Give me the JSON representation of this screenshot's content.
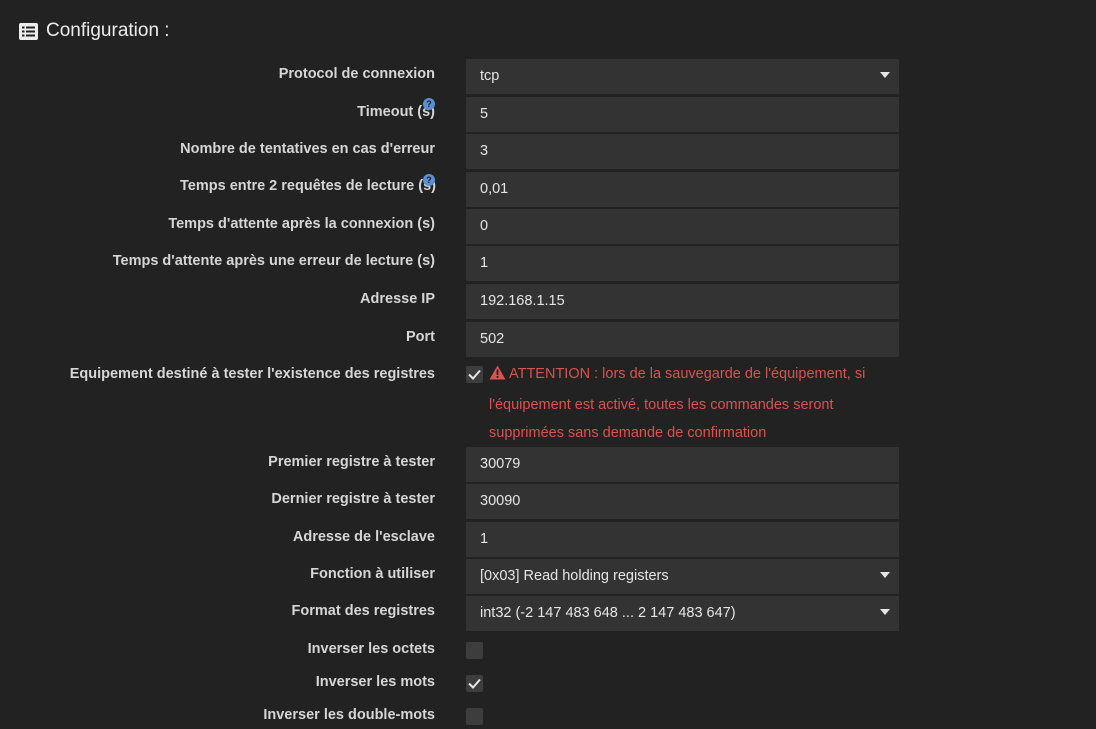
{
  "header": {
    "icon": "list-alt-icon",
    "title": "Configuration :"
  },
  "fields": {
    "protocol": {
      "label": "Protocol de connexion",
      "value": "tcp"
    },
    "timeout": {
      "label": "Timeout (s)",
      "value": "5"
    },
    "retries": {
      "label": "Nombre de tentatives en cas d'erreur",
      "value": "3"
    },
    "read_delay": {
      "label": "Temps entre 2 requêtes de lecture (s)",
      "value": "0,01"
    },
    "connect_wait": {
      "label": "Temps d'attente après la connexion (s)",
      "value": "0"
    },
    "error_wait": {
      "label": "Temps d'attente après une erreur de lecture (s)",
      "value": "1"
    },
    "ip": {
      "label": "Adresse IP",
      "value": "192.168.1.15"
    },
    "port": {
      "label": "Port",
      "value": "502"
    },
    "test_equipment": {
      "label": "Equipement destiné à tester l'existence des registres",
      "checked": true,
      "warning": "ATTENTION : lors de la sauvegarde de l'équipement, si l'équipement est activé, toutes les commandes seront supprimées sans demande de confirmation"
    },
    "first_register": {
      "label": "Premier registre à tester",
      "value": "30079"
    },
    "last_register": {
      "label": "Dernier registre à tester",
      "value": "30090"
    },
    "slave_address": {
      "label": "Adresse de l'esclave",
      "value": "1"
    },
    "function": {
      "label": "Fonction à utiliser",
      "value": "[0x03] Read holding registers"
    },
    "format": {
      "label": "Format des registres",
      "value": "int32 (-2 147 483 648 ... 2 147 483 647)"
    },
    "swap_bytes": {
      "label": "Inverser les octets",
      "checked": false
    },
    "swap_words": {
      "label": "Inverser les mots",
      "checked": true
    },
    "swap_dwords": {
      "label": "Inverser les double-mots",
      "checked": false
    }
  },
  "colors": {
    "background": "#222222",
    "field": "#333333",
    "warning": "#d9534f",
    "help": "#5a8fd0"
  }
}
